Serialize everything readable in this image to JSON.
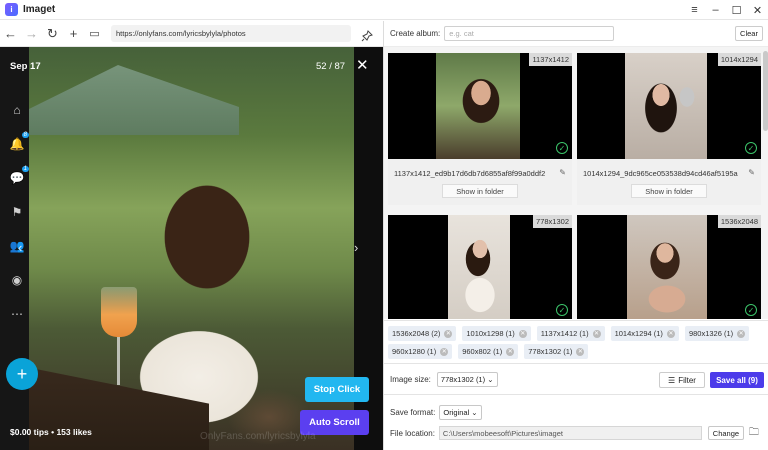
{
  "app": {
    "title": "Imaget",
    "logo_letter": "i"
  },
  "window": {
    "menu_icon": "≡",
    "minimize_icon": "–",
    "maximize_icon": "☐",
    "close_icon": "✕"
  },
  "browser": {
    "back_icon": "←",
    "forward_icon": "→",
    "reload_icon": "↻",
    "newtab_icon": "+",
    "tabs_icon": "▭",
    "url": "https://onlyfans.com/lyricsbylyla/photos",
    "pin_icon": "📌"
  },
  "viewer": {
    "date": "Sep 17",
    "counter": "52 / 87",
    "close_icon": "✕",
    "prev_icon": "‹",
    "next_icon": "›",
    "tips_text": "$0.00 tips • 153 likes",
    "watermark": "OnlyFans.com/lyricsbylyla",
    "stop_click": "Stop Click",
    "auto_scroll": "Auto Scroll",
    "fab_icon": "+",
    "side_icons": [
      {
        "icon": "⌂",
        "name": "home-icon",
        "badge": ""
      },
      {
        "icon": "🔔",
        "name": "bell-icon",
        "badge": ""
      },
      {
        "icon": "💬",
        "name": "chat-icon",
        "badge": "1"
      },
      {
        "icon": "⚑",
        "name": "bookmark-icon",
        "badge": ""
      },
      {
        "icon": "👥",
        "name": "users-icon",
        "badge": ""
      },
      {
        "icon": "◉",
        "name": "profile-icon",
        "badge": ""
      },
      {
        "icon": "⋯",
        "name": "more-icon",
        "badge": ""
      }
    ]
  },
  "album": {
    "label": "Create album:",
    "placeholder": "e.g. cat",
    "clear": "Clear"
  },
  "images": [
    {
      "size": "1137x1412",
      "filename": "1137x1412_ed9b17d6db7d6855af8f99a0ddf2",
      "show": "Show in folder",
      "tone": "#b08a6c"
    },
    {
      "size": "1014x1294",
      "filename": "1014x1294_9dc965ce053538d94cd46af5195a",
      "show": "Show in folder",
      "tone": "#c9b4a4"
    },
    {
      "size": "778x1302",
      "filename": "",
      "show": "",
      "tone": "#d9d2c8"
    },
    {
      "size": "1536x2048",
      "filename": "",
      "show": "",
      "tone": "#c09a82"
    }
  ],
  "chips": [
    "1536x2048 (2)",
    "1010x1298 (1)",
    "1137x1412 (1)",
    "1014x1294 (1)",
    "980x1326 (1)",
    "960x1280 (1)",
    "960x802 (1)",
    "778x1302 (1)"
  ],
  "controls": {
    "size_label": "Image size:",
    "size_value": "778x1302 (1)",
    "filter": "Filter",
    "save_all": "Save all (9)",
    "format_label": "Save format:",
    "format_value": "Original",
    "location_label": "File location:",
    "location_value": "C:\\Users\\mobeesoft\\Pictures\\imaget",
    "change": "Change"
  }
}
